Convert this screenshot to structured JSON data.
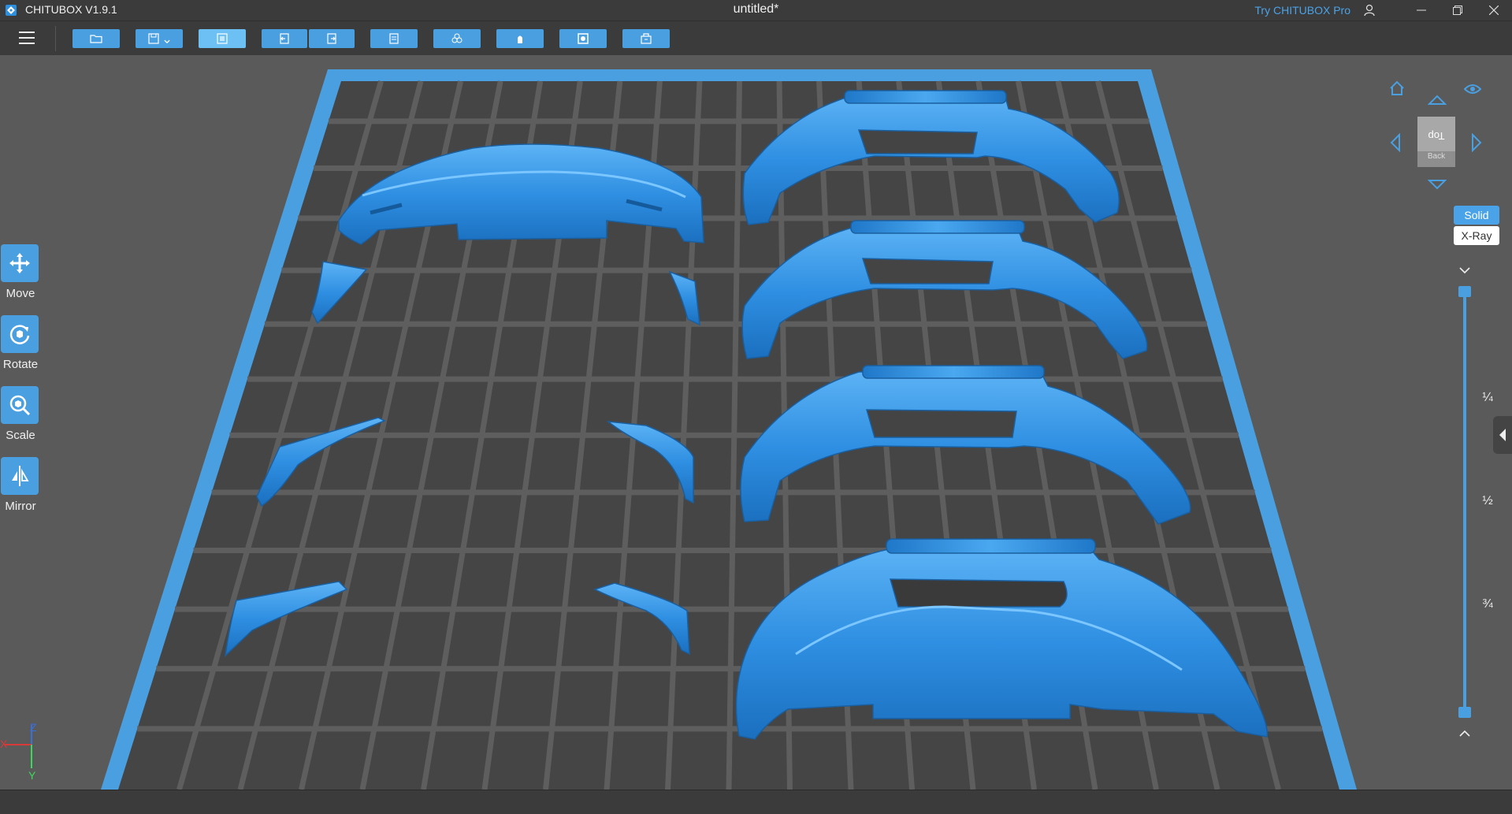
{
  "window": {
    "app_title": "CHITUBOX V1.9.1",
    "doc_title": "untitled*",
    "try_pro_label": "Try CHITUBOX Pro",
    "icons": [
      "app-logo-icon",
      "user-icon",
      "minimize-icon",
      "restore-icon",
      "close-icon"
    ]
  },
  "toolbar": {
    "buttons": [
      {
        "name": "open-file",
        "icon": "folder-icon"
      },
      {
        "name": "save-file",
        "icon": "save-icon"
      },
      {
        "name": "auto-layout",
        "icon": "layout-icon",
        "active": true
      },
      {
        "name": "undo",
        "icon": "undo-icon"
      },
      {
        "name": "redo",
        "icon": "redo-icon"
      },
      {
        "name": "copy",
        "icon": "copy-icon"
      },
      {
        "name": "arrange",
        "icon": "arrange-icon"
      },
      {
        "name": "support",
        "icon": "support-icon"
      },
      {
        "name": "hollow",
        "icon": "hollow-icon"
      },
      {
        "name": "print-box",
        "icon": "box-icon"
      }
    ]
  },
  "left_tools": {
    "move": "Move",
    "rotate": "Rotate",
    "scale": "Scale",
    "mirror": "Mirror"
  },
  "axis": {
    "x": "X",
    "y": "Y",
    "z": "Z"
  },
  "view_cube": {
    "top_face": "Top",
    "front_face": "Back"
  },
  "render_mode": {
    "solid": "Solid",
    "xray": "X-Ray",
    "selected": "Solid"
  },
  "layer_slider": {
    "marks": [
      "¼",
      "½",
      "¾"
    ],
    "range": [
      0,
      1
    ],
    "low": 0,
    "high": 1
  },
  "colors": {
    "accent": "#4a9fe0",
    "model": "#2d8fe0",
    "platform_border": "#4a9fe0",
    "background": "#5a5a5a"
  }
}
